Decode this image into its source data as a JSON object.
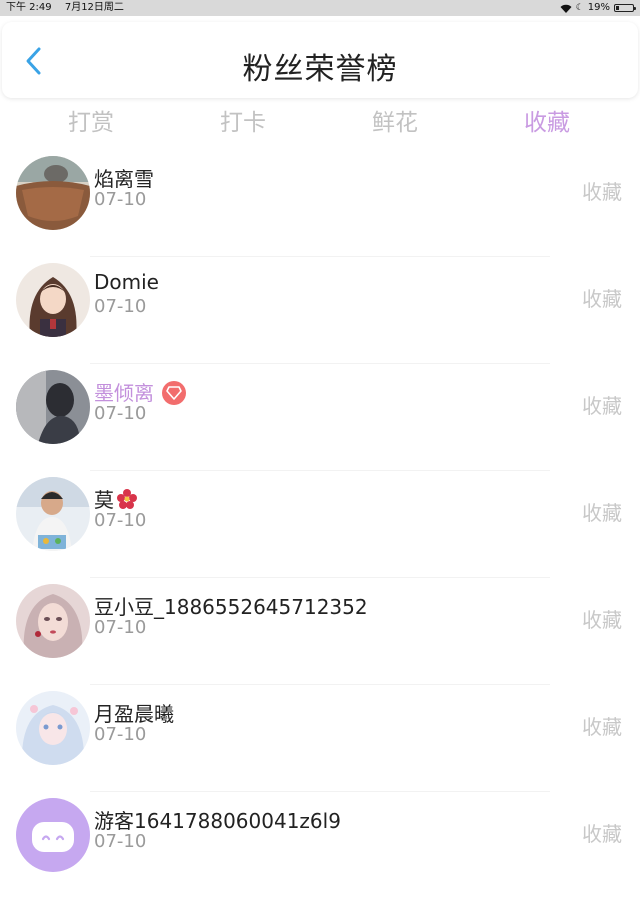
{
  "status_bar": {
    "time": "下午 2:49",
    "date": "7月12日周二",
    "battery": "19%",
    "battery_level": 0.19
  },
  "header": {
    "title": "粉丝荣誉榜"
  },
  "tabs": [
    {
      "label": "打赏",
      "active": false
    },
    {
      "label": "打卡",
      "active": false
    },
    {
      "label": "鲜花",
      "active": false
    },
    {
      "label": "收藏",
      "active": true
    }
  ],
  "list": [
    {
      "name": "焰离雪",
      "date": "07-10",
      "action": "收藏",
      "avatar": "avatar-cat-bowl"
    },
    {
      "name": "Domie",
      "date": "07-10",
      "action": "收藏",
      "avatar": "avatar-anime-girl"
    },
    {
      "name": "墨倾离",
      "date": "07-10",
      "action": "收藏",
      "avatar": "avatar-dark-photo",
      "vip": true
    },
    {
      "name": "莫",
      "date": "07-10",
      "action": "收藏",
      "avatar": "avatar-child-photo",
      "emoji": "flower-icon"
    },
    {
      "name": "豆小豆_1886552645712352",
      "date": "07-10",
      "action": "收藏",
      "avatar": "avatar-portrait-girl"
    },
    {
      "name": "月盈晨曦",
      "date": "07-10",
      "action": "收藏",
      "avatar": "avatar-pastel-anime"
    },
    {
      "name": "游客1641788060041z6l9",
      "date": "07-10",
      "action": "收藏",
      "avatar": "avatar-default-purple"
    }
  ],
  "colors": {
    "accent": "#c99be2",
    "vip_name": "#c390dc",
    "back_arrow": "#3aa3e6",
    "inactive_tab": "#c2c2c2"
  }
}
